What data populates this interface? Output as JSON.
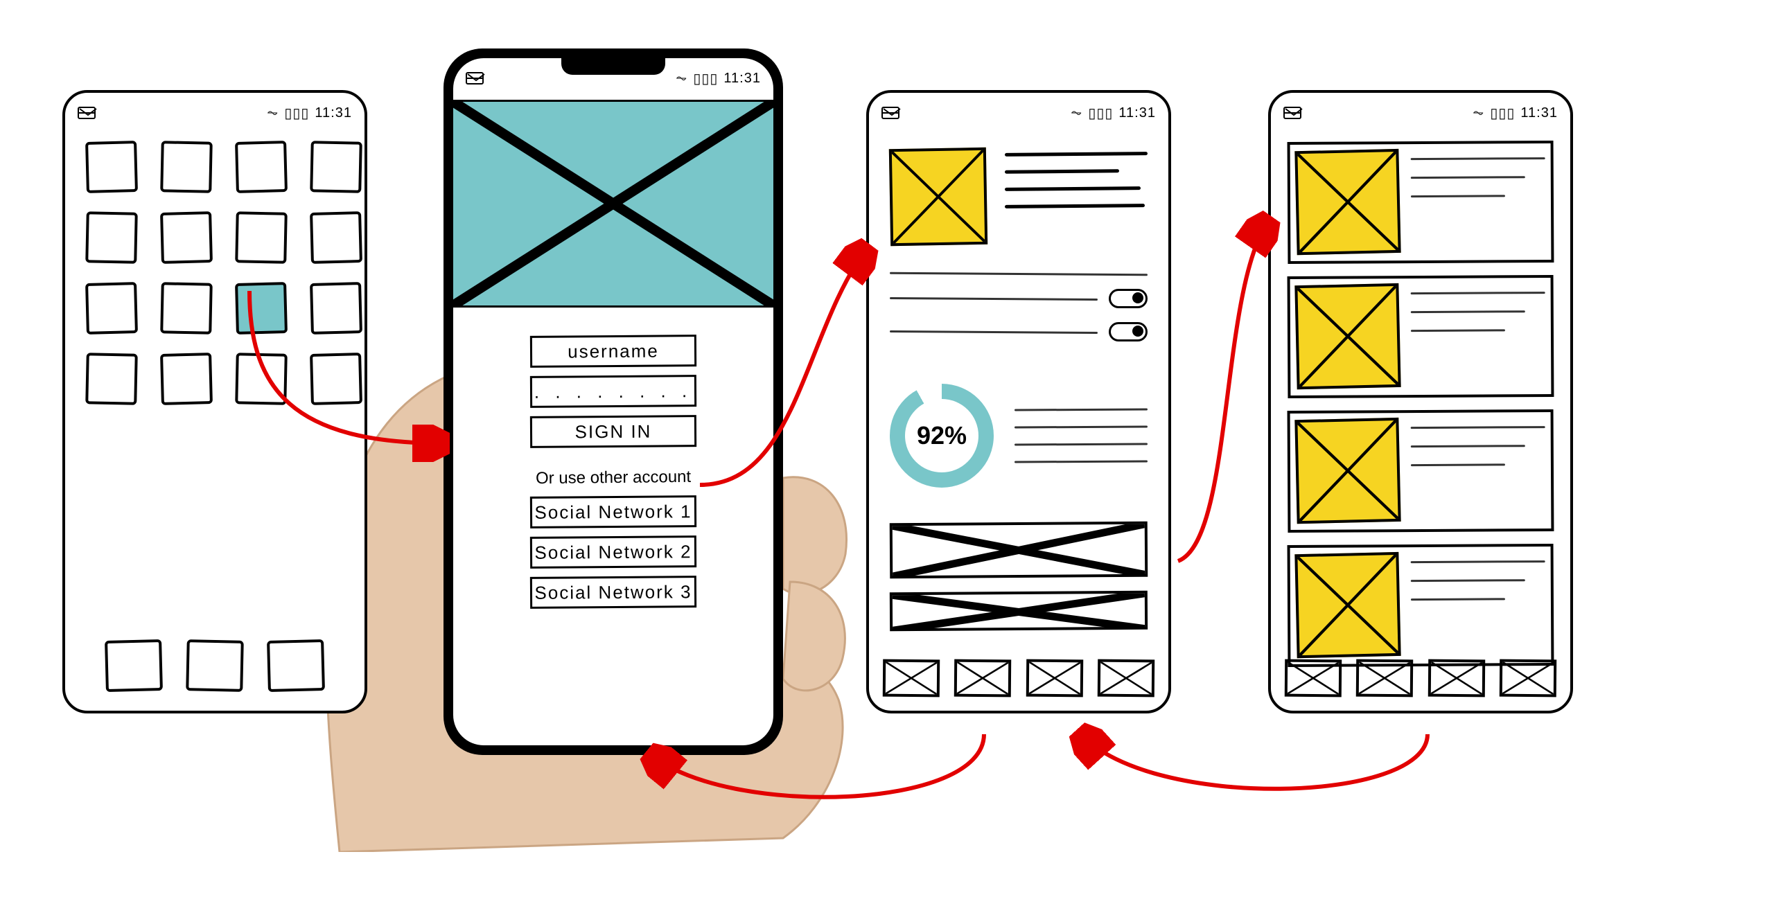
{
  "status": {
    "time": "11:31"
  },
  "colors": {
    "teal": "#79c6c9",
    "yellow": "#f6d422",
    "arrow": "#e20000"
  },
  "screen1": {
    "grid_rows": 4,
    "grid_cols": 4,
    "highlighted_index": 10,
    "dock_count": 3
  },
  "screen2": {
    "username_label": "username",
    "password_mask": ". . . . . . . .",
    "signin_label": "SIGN IN",
    "alt_label": "Or use other account",
    "social": [
      "Social Network 1",
      "Social Network 2",
      "Social Network 3"
    ]
  },
  "screen3": {
    "progress_pct": "92%",
    "toggles": [
      true,
      true
    ],
    "tab_count": 4
  },
  "screen4": {
    "card_count": 4,
    "tab_count": 4
  },
  "flow": [
    {
      "from": "home-highlighted-app",
      "to": "signin-form"
    },
    {
      "from": "signin-button",
      "to": "dashboard"
    },
    {
      "from": "dashboard-banner",
      "to": "list-view"
    },
    {
      "from": "dashboard-tabbar",
      "to": "signin-home-indicator"
    },
    {
      "from": "list-tabbar",
      "to": "dashboard-tabbar"
    }
  ]
}
